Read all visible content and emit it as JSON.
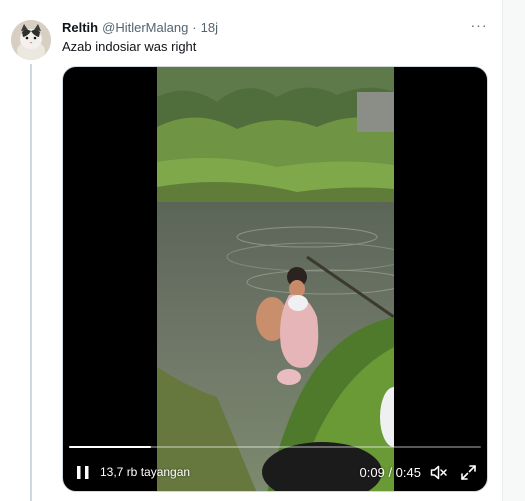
{
  "tweet": {
    "display_name": "Reltih",
    "handle": "@HitlerMalang",
    "separator": "·",
    "timestamp": "18j",
    "more_label": "···",
    "text": "Azab indosiar was right"
  },
  "video": {
    "views": "13,7 rb tayangan",
    "time_readout": "0:09 / 0:45",
    "progress_fraction": 0.2,
    "state": "playing",
    "muted": true
  },
  "colors": {
    "name": "#0f1419",
    "secondary": "#536471",
    "player_background": "#000000"
  },
  "icons": {
    "more": "more-icon",
    "pause": "pause-icon",
    "mute": "mute-icon",
    "fullscreen": "fullscreen-icon"
  }
}
